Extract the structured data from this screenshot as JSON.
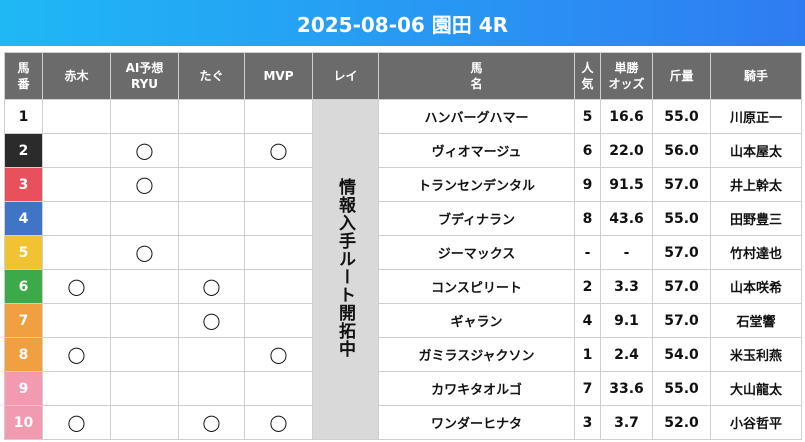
{
  "title": "2025-08-06 園田 4R",
  "headers": {
    "umaban": "馬\n番",
    "akagi": "赤木",
    "ai": "AI予想\nRYU",
    "tagu": "たぐ",
    "mvp": "MVP",
    "rei": "レイ",
    "horse": "馬\n名",
    "ninki": "人\n気",
    "odds": "単勝\nオッズ",
    "kinryo": "斤量",
    "jockey": "騎手"
  },
  "rei_note": "情報入手ルート開拓中",
  "mark_symbol": "◯",
  "rows": [
    {
      "num": "1",
      "color": "#ffffff",
      "text_color": "#111111",
      "akagi": "",
      "ai": "",
      "tagu": "",
      "mvp": "",
      "horse": "ハンバーグハマー",
      "ninki": "5",
      "odds": "16.6",
      "kinryo": "55.0",
      "jockey": "川原正一"
    },
    {
      "num": "2",
      "color": "#2b2b2b",
      "text_color": "#ffffff",
      "akagi": "",
      "ai": "◯",
      "tagu": "",
      "mvp": "◯",
      "horse": "ヴィオマージュ",
      "ninki": "6",
      "odds": "22.0",
      "kinryo": "56.0",
      "jockey": "山本屋太"
    },
    {
      "num": "3",
      "color": "#e8505b",
      "text_color": "#ffffff",
      "akagi": "",
      "ai": "◯",
      "tagu": "",
      "mvp": "",
      "horse": "トランセンデンタル",
      "ninki": "9",
      "odds": "91.5",
      "kinryo": "57.0",
      "jockey": "井上幹太"
    },
    {
      "num": "4",
      "color": "#3f74c7",
      "text_color": "#ffffff",
      "akagi": "",
      "ai": "",
      "tagu": "",
      "mvp": "",
      "horse": "ブディナラン",
      "ninki": "8",
      "odds": "43.6",
      "kinryo": "55.0",
      "jockey": "田野豊三"
    },
    {
      "num": "5",
      "color": "#f1c232",
      "text_color": "#ffffff",
      "akagi": "",
      "ai": "◯",
      "tagu": "",
      "mvp": "",
      "horse": "ジーマックス",
      "ninki": "-",
      "odds": "-",
      "kinryo": "57.0",
      "jockey": "竹村達也"
    },
    {
      "num": "6",
      "color": "#3daa4a",
      "text_color": "#ffffff",
      "akagi": "◯",
      "ai": "",
      "tagu": "◯",
      "mvp": "",
      "horse": "コンスピリート",
      "ninki": "2",
      "odds": "3.3",
      "kinryo": "57.0",
      "jockey": "山本咲希"
    },
    {
      "num": "7",
      "color": "#f0a040",
      "text_color": "#ffffff",
      "akagi": "",
      "ai": "",
      "tagu": "◯",
      "mvp": "",
      "horse": "ギャラン",
      "ninki": "4",
      "odds": "9.1",
      "kinryo": "57.0",
      "jockey": "石堂響"
    },
    {
      "num": "8",
      "color": "#f0a040",
      "text_color": "#ffffff",
      "akagi": "◯",
      "ai": "",
      "tagu": "",
      "mvp": "◯",
      "horse": "ガミラスジャクソン",
      "ninki": "1",
      "odds": "2.4",
      "kinryo": "54.0",
      "jockey": "米玉利燕"
    },
    {
      "num": "9",
      "color": "#f29bb0",
      "text_color": "#ffffff",
      "akagi": "",
      "ai": "",
      "tagu": "",
      "mvp": "",
      "horse": "カワキタオルゴ",
      "ninki": "7",
      "odds": "33.6",
      "kinryo": "55.0",
      "jockey": "大山龍太"
    },
    {
      "num": "10",
      "color": "#f29bb0",
      "text_color": "#ffffff",
      "akagi": "◯",
      "ai": "",
      "tagu": "◯",
      "mvp": "◯",
      "horse": "ワンダーヒナタ",
      "ninki": "3",
      "odds": "3.7",
      "kinryo": "52.0",
      "jockey": "小谷哲平"
    }
  ]
}
